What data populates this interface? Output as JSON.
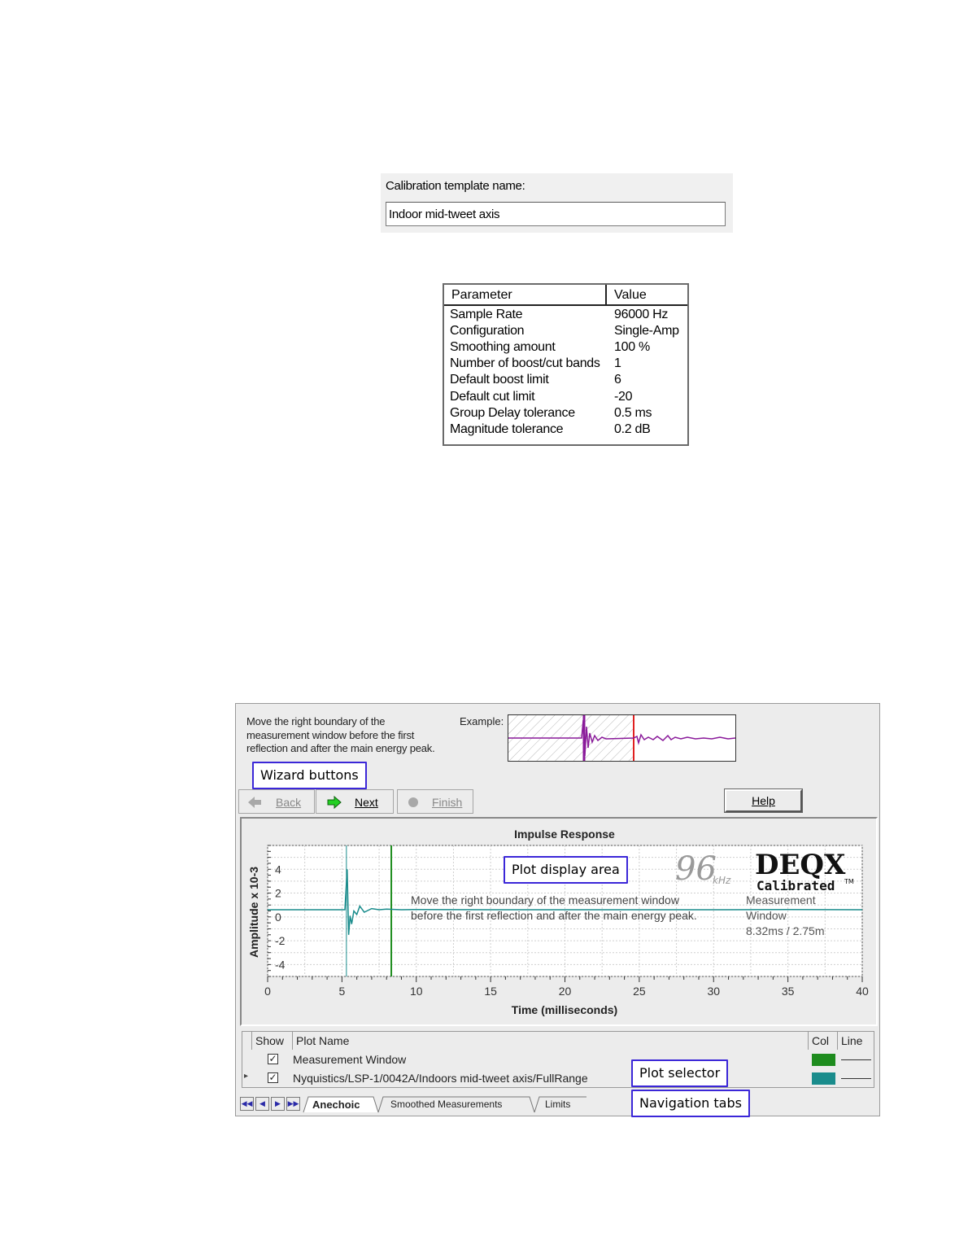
{
  "calibration": {
    "label": "Calibration template name:",
    "value": "Indoor mid-tweet axis"
  },
  "parameters": {
    "header": {
      "param": "Parameter",
      "value": "Value"
    },
    "rows": [
      {
        "name": "Sample Rate",
        "value": "96000 Hz"
      },
      {
        "name": "Configuration",
        "value": "Single-Amp"
      },
      {
        "name": "Smoothing amount",
        "value": "100 %"
      },
      {
        "name": "Number of boost/cut bands",
        "value": "1"
      },
      {
        "name": "Default boost limit",
        "value": "6"
      },
      {
        "name": "Default cut limit",
        "value": "-20"
      },
      {
        "name": "Group Delay tolerance",
        "value": "0.5 ms"
      },
      {
        "name": "Magnitude tolerance",
        "value": "0.2 dB"
      }
    ]
  },
  "wizard": {
    "instruction_lines": [
      "Move the right boundary of the",
      "measurement window before the first",
      "reflection and after the main energy peak."
    ],
    "example_label": "Example:",
    "back_label": "Back",
    "next_label": "Next",
    "finish_label": "Finish",
    "help_label": "Help"
  },
  "callouts": {
    "wizard_buttons": "Wizard buttons",
    "plot_display_area": "Plot display area",
    "plot_selector": "Plot selector",
    "navigation_tabs": "Navigation tabs"
  },
  "plot": {
    "overlay_text_1": "Move the right boundary of the measurement window",
    "overlay_text_2": "before the first reflection and after the main energy peak.",
    "window_label_1": "Measurement",
    "window_label_2": "Window",
    "window_value": "8.32ms / 2.75m",
    "logo_rate": "96",
    "logo_unit": "kHz",
    "logo_brand": "DEQX",
    "logo_sub": "Calibrated",
    "logo_tm": "TM"
  },
  "chart_data": {
    "type": "line",
    "title": "Impulse Response",
    "xlabel": "Time (milliseconds)",
    "ylabel": "Amplitude x 10-3",
    "xlim": [
      0,
      40
    ],
    "ylim": [
      -5,
      6
    ],
    "xticks": [
      0,
      5,
      10,
      15,
      20,
      25,
      30,
      35,
      40
    ],
    "yticks": [
      4,
      2,
      0,
      -2,
      -4
    ],
    "grid": true,
    "colors": {
      "measurement_window": "#1e8c1e",
      "impulse": "#1a8c8c"
    },
    "series": [
      {
        "name": "Nyquistics/LSP-1/0042A/Indoors mid-tweet axis/FullRange",
        "x": [
          0,
          5.2,
          5.35,
          5.45,
          5.55,
          5.65,
          5.8,
          6.0,
          6.2,
          6.5,
          7.0,
          7.5,
          8.0,
          9,
          10,
          15,
          20,
          25,
          30,
          35,
          40
        ],
        "y": [
          0.6,
          0.6,
          4.0,
          -1.5,
          0.1,
          -0.6,
          0.5,
          0.2,
          0.9,
          0.4,
          0.7,
          0.6,
          0.65,
          0.6,
          0.62,
          0.6,
          0.6,
          0.6,
          0.6,
          0.62,
          0.6
        ]
      }
    ],
    "vlines": [
      {
        "name": "Measurement Window",
        "x": 8.32
      }
    ]
  },
  "selector": {
    "headers": {
      "show": "Show",
      "plot_name": "Plot Name",
      "col": "Col",
      "line": "Line"
    },
    "rows": [
      {
        "name": "Measurement Window",
        "checked": true,
        "color": "#1e8c1e"
      },
      {
        "name": "Nyquistics/LSP-1/0042A/Indoors mid-tweet axis/FullRange",
        "checked": true,
        "color": "#1a8c8c"
      }
    ]
  },
  "tabs": [
    "Anechoic",
    "Smoothed Measurements",
    "Limits"
  ]
}
